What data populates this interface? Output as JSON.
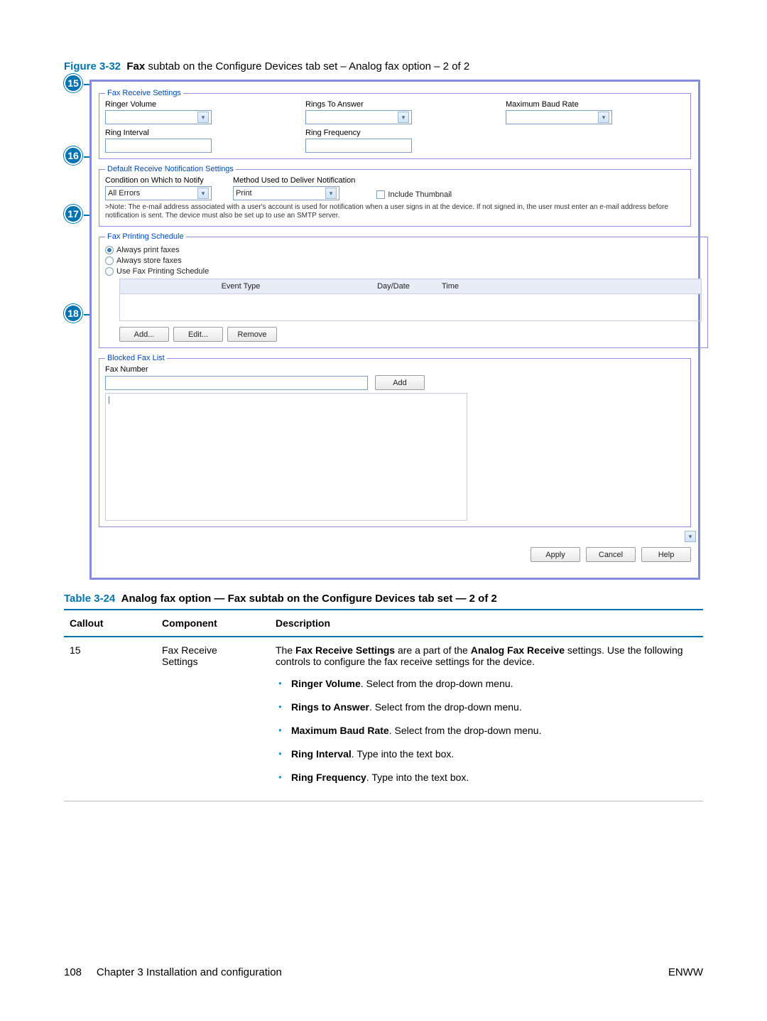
{
  "figure": {
    "number": "Figure 3-32",
    "title_prefix": "Fax",
    "title_rest": " subtab on the Configure Devices tab set – Analog fax option – 2 of 2"
  },
  "screenshot": {
    "receive": {
      "legend": "Fax Receive Settings",
      "ringer_volume": "Ringer Volume",
      "rings_to_answer": "Rings To Answer",
      "max_baud": "Maximum Baud Rate",
      "ring_interval": "Ring Interval",
      "ring_frequency": "Ring Frequency"
    },
    "notify": {
      "legend": "Default Receive Notification Settings",
      "condition": "Condition on Which to Notify",
      "condition_val": "All Errors",
      "method": "Method Used to Deliver Notification",
      "method_val": "Print",
      "thumb": "Include Thumbnail",
      "note": ">Note: The e-mail address associated with a user's account is used for notification when a user signs in at the device. If not signed in, the user must enter an e-mail address before notification is sent. The device must also be set up to use an SMTP server."
    },
    "schedule": {
      "legend": "Fax Printing Schedule",
      "always_print": "Always print faxes",
      "always_store": "Always store faxes",
      "use_schedule": "Use Fax Printing Schedule",
      "col_event": "Event Type",
      "col_day": "Day/Date",
      "col_time": "Time",
      "add": "Add...",
      "edit": "Edit...",
      "remove": "Remove"
    },
    "blocked": {
      "legend": "Blocked Fax List",
      "faxnum": "Fax Number",
      "add": "Add"
    },
    "buttons": {
      "apply": "Apply",
      "cancel": "Cancel",
      "help": "Help"
    }
  },
  "callouts": {
    "c15": "15",
    "c16": "16",
    "c17": "17",
    "c18": "18"
  },
  "table": {
    "caption_num": "Table 3-24",
    "caption_text": "Analog fax option — Fax subtab on the Configure Devices tab set — 2 of 2",
    "head": {
      "callout": "Callout",
      "component": "Component",
      "description": "Description"
    },
    "row": {
      "callout": "15",
      "component_l1": "Fax Receive",
      "component_l2": "Settings",
      "desc_pre": "The ",
      "desc_b1": "Fax Receive Settings",
      "desc_mid": " are a part of the ",
      "desc_b2": "Analog Fax Receive",
      "desc_post": " settings. Use the following controls to configure the fax receive settings for the device.",
      "bullets": {
        "b1b": "Ringer Volume",
        "b1t": ". Select from the drop-down menu.",
        "b2b": "Rings to Answer",
        "b2t": ". Select from the drop-down menu.",
        "b3b": "Maximum Baud Rate",
        "b3t": ". Select from the drop-down menu.",
        "b4b": "Ring Interval",
        "b4t": ". Type into the text box.",
        "b5b": "Ring Frequency",
        "b5t": ". Type into the text box."
      }
    }
  },
  "footer": {
    "page": "108",
    "chapter": "Chapter 3   Installation and configuration",
    "right": "ENWW"
  }
}
